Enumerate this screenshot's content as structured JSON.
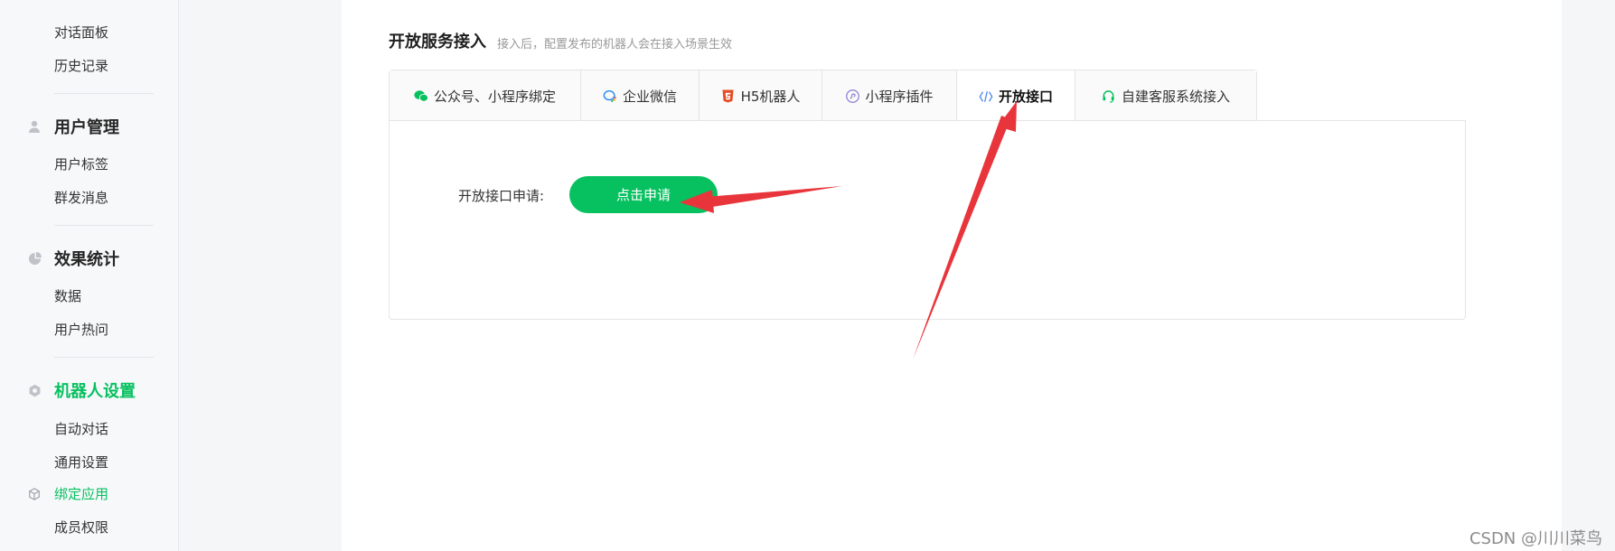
{
  "sidebar": {
    "groups": [
      {
        "title": "用户管理",
        "icon": "user-icon",
        "items": [
          "用户标签",
          "群发消息"
        ]
      },
      {
        "title": "效果统计",
        "icon": "pie-chart-icon",
        "items": [
          "数据",
          "用户热问"
        ]
      },
      {
        "title": "机器人设置",
        "icon": "gear-icon",
        "items": [
          "自动对话",
          "通用设置"
        ]
      }
    ],
    "top_items": [
      "对话面板",
      "历史记录"
    ],
    "bind_app": "绑定应用",
    "member_perm": "成员权限"
  },
  "main": {
    "section_title": "开放服务接入",
    "section_subtitle": "接入后，配置发布的机器人会在接入场景生效",
    "tabs": [
      {
        "label": "公众号、小程序绑定",
        "icon": "wechat-icon"
      },
      {
        "label": "企业微信",
        "icon": "work-wechat-icon"
      },
      {
        "label": "H5机器人",
        "icon": "html5-icon"
      },
      {
        "label": "小程序插件",
        "icon": "mini-program-icon"
      },
      {
        "label": "开放接口",
        "icon": "code-icon"
      },
      {
        "label": "自建客服系统接入",
        "icon": "headset-icon"
      }
    ],
    "active_tab": "开放接口",
    "apply_label": "开放接口申请:",
    "apply_button": "点击申请"
  },
  "watermark": "CSDN @川川菜鸟",
  "colors": {
    "accent": "#07c160",
    "annotation_arrow": "#e8353b"
  }
}
